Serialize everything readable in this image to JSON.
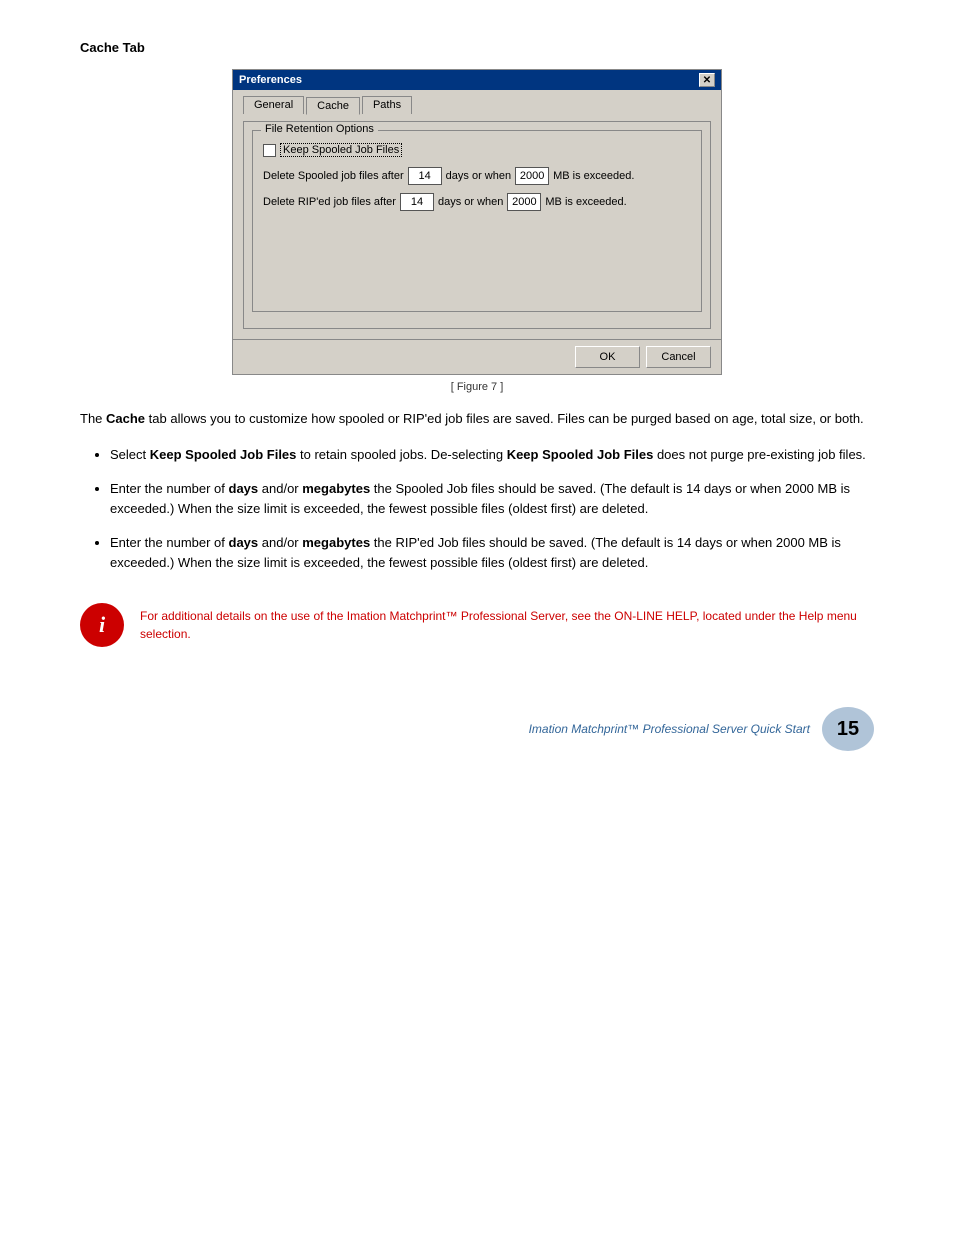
{
  "page": {
    "heading": "Cache Tab",
    "figure_caption": "[ Figure 7 ]"
  },
  "dialog": {
    "title": "Preferences",
    "close_label": "✕",
    "tabs": [
      {
        "label": "General",
        "active": false
      },
      {
        "label": "Cache",
        "active": true
      },
      {
        "label": "Paths",
        "active": false
      }
    ],
    "group_box_label": "File Retention Options",
    "checkbox_label": "Keep Spooled Job Files",
    "spooled_row": {
      "prefix": "Delete Spooled job files after",
      "days_value": "14",
      "middle": "days or when",
      "mb_value": "2000",
      "suffix": "MB is exceeded."
    },
    "riped_row": {
      "prefix": "Delete RIP'ed job files after",
      "days_value": "14",
      "middle": "days or when",
      "mb_value": "2000",
      "suffix": "MB is exceeded."
    },
    "ok_label": "OK",
    "cancel_label": "Cancel"
  },
  "body": {
    "intro": "The ",
    "intro_bold": "Cache",
    "intro_rest": " tab allows you to customize how spooled or RIP'ed job files are saved. Files can be purged based on age, total size, or both.",
    "bullets": [
      {
        "text_start": "Select ",
        "bold1": "Keep Spooled Job Files",
        "text_mid": " to retain spooled jobs. De-selecting ",
        "bold2": "Keep Spooled Job Files",
        "text_end": " does not purge pre-existing job files."
      },
      {
        "text_start": "Enter the number of ",
        "bold1": "days",
        "text_mid": " and/or ",
        "bold2": "megabytes",
        "text_end": " the Spooled Job files should be saved. (The default is 14 days or when 2000 MB is exceeded.) When the size limit is exceeded, the fewest possible files (oldest first) are deleted."
      },
      {
        "text_start": "Enter the number of ",
        "bold1": "days",
        "text_mid": " and/or ",
        "bold2": "megabytes",
        "text_end": " the RIP'ed Job files should be saved. (The default is 14 days or when 2000 MB is exceeded.) When the size limit is exceeded, the fewest possible files (oldest first) are deleted."
      }
    ]
  },
  "info_note": {
    "icon_text": "i",
    "text": "For additional details on the use of the Imation Matchprint™ Professional Server, see the ON-LINE HELP, located under the Help menu selection."
  },
  "footer": {
    "text": "Imation Matchprint™ Professional Server Quick Start",
    "page_number": "15"
  }
}
